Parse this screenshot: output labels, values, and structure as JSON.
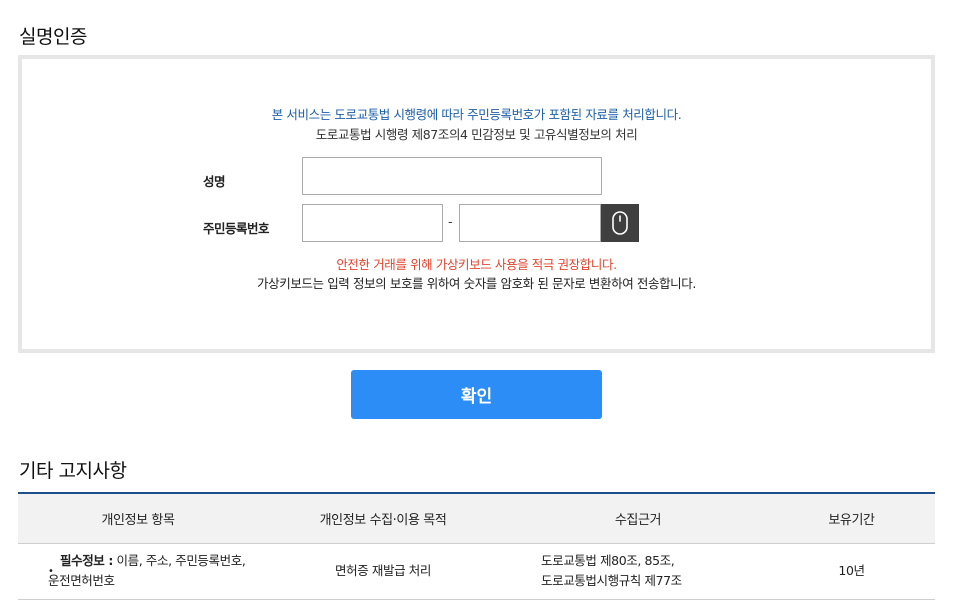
{
  "page": {
    "title": "실명인증"
  },
  "auth": {
    "notice_blue": "본 서비스는 도로교통법 시행령에 따라 주민등록번호가 포함된 자료를 처리합니다.",
    "notice_black": "도로교통법 시행령 제87조의4 민감정보 및 고유식별정보의 처리",
    "name_label": "성명",
    "name_value": "",
    "rrn_label": "주민등록번호",
    "rrn_first_value": "",
    "rrn_separator": "-",
    "rrn_second_value": "",
    "keypad_icon": "mouse-icon",
    "warning_red": "안전한 거래를 위해 가상키보드 사용을 적극 권장합니다.",
    "warning_black": "가상키보드는 입력 정보의 보호를 위하여 숫자를 암호화 된 문자로 변환하여 전송합니다."
  },
  "confirm_label": "확인",
  "notice": {
    "title": "기타 고지사항",
    "headers": [
      "개인정보 항목",
      "개인정보 수집·이용 목적",
      "수집근거",
      "보유기간"
    ],
    "row": {
      "bullet": "•",
      "item_bold": "필수정보 :",
      "item_text_1": " 이름, 주소, 주민등록번호,",
      "item_text_2": "운전면허번호",
      "purpose": "면허증 재발급 처리",
      "basis_1": "도로교통법 제80조, 85조,",
      "basis_2": "도로교통법시행규칙 제77조",
      "retention": "10년"
    }
  },
  "colors": {
    "accent_blue": "#2b8df5",
    "notice_blue": "#1d5fa8",
    "warning_red": "#e0452f",
    "table_top_border": "#1d4f8c"
  }
}
